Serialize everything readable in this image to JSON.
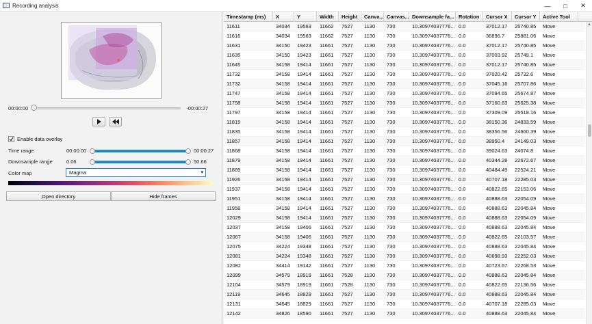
{
  "window": {
    "title": "Recording analysis",
    "icon": "window-app-icon"
  },
  "player": {
    "time_start": "00:00:00",
    "time_end": "-00:00:27",
    "progress": 0.0
  },
  "overlay": {
    "enable_label": "Enable data overlay",
    "enabled": true,
    "time_range": {
      "label": "Time range",
      "min": "00:00:00",
      "max": "00:00:27",
      "low": 0.0,
      "high": 1.0
    },
    "downsample_range": {
      "label": "Downsample range",
      "min": "0.06",
      "max": "50.66",
      "low": 0.0,
      "high": 1.0
    },
    "color_map": {
      "label": "Color map",
      "value": "Magma"
    }
  },
  "buttons": {
    "open_directory": "Open directory",
    "hide_frames": "Hide frames"
  },
  "colors": {
    "accent": "#1e88c9",
    "select_border": "#2a7fd1"
  },
  "table": {
    "columns": [
      "Timestamp (ms)",
      "X",
      "Y",
      "Width",
      "Height",
      "Canva...",
      "Canvas...",
      "Downsample fa...",
      "Rotation",
      "Cursor X",
      "Cursor Y",
      "Active Tool"
    ],
    "rows": [
      [
        "11611",
        "34034",
        "19563",
        "11662",
        "7527",
        "1130",
        "730",
        "10.30974037776...",
        "0.0",
        "37012.17",
        "25740.85",
        "Move"
      ],
      [
        "11616",
        "34034",
        "19563",
        "11662",
        "7527",
        "1130",
        "730",
        "10.30974037776...",
        "0.0",
        "36896.7",
        "25881.06",
        "Move"
      ],
      [
        "11631",
        "34150",
        "19423",
        "11661",
        "7527",
        "1130",
        "730",
        "10.30974037776...",
        "0.0",
        "37012.17",
        "25740.85",
        "Move"
      ],
      [
        "11635",
        "34150",
        "19423",
        "11661",
        "7527",
        "1130",
        "730",
        "10.30974037776...",
        "0.0",
        "37003.92",
        "25749.1",
        "Move"
      ],
      [
        "11645",
        "34158",
        "19414",
        "11661",
        "7527",
        "1130",
        "730",
        "10.30974037776...",
        "0.0",
        "37012.17",
        "25740.85",
        "Move"
      ],
      [
        "11732",
        "34158",
        "19414",
        "11661",
        "7527",
        "1130",
        "730",
        "10.30974037776...",
        "0.0",
        "37020.42",
        "25732.6",
        "Move"
      ],
      [
        "11732",
        "34158",
        "19414",
        "11661",
        "7527",
        "1130",
        "730",
        "10.30974037776...",
        "0.0",
        "37045.16",
        "25707.86",
        "Move"
      ],
      [
        "11747",
        "34158",
        "19414",
        "11661",
        "7527",
        "1130",
        "730",
        "10.30974037776...",
        "0.0",
        "37094.65",
        "25674.87",
        "Move"
      ],
      [
        "11758",
        "34158",
        "19414",
        "11661",
        "7527",
        "1130",
        "730",
        "10.30974037776...",
        "0.0",
        "37160.63",
        "25625.38",
        "Move"
      ],
      [
        "11797",
        "34158",
        "19414",
        "11661",
        "7527",
        "1130",
        "730",
        "10.30974037776...",
        "0.0",
        "37309.09",
        "25518.16",
        "Move"
      ],
      [
        "11815",
        "34158",
        "19414",
        "11661",
        "7527",
        "1130",
        "730",
        "10.30974037776...",
        "0.0",
        "38150.36",
        "24833.59",
        "Move"
      ],
      [
        "11835",
        "34158",
        "19414",
        "11661",
        "7527",
        "1130",
        "730",
        "10.30974037776...",
        "0.0",
        "38356.56",
        "24660.39",
        "Move"
      ],
      [
        "11857",
        "34158",
        "19414",
        "11661",
        "7527",
        "1130",
        "730",
        "10.30974037776...",
        "0.0",
        "38950.4",
        "24149.03",
        "Move"
      ],
      [
        "11868",
        "34158",
        "19414",
        "11661",
        "7527",
        "1130",
        "730",
        "10.30974037776...",
        "0.0",
        "39024.63",
        "24074.8",
        "Move"
      ],
      [
        "11879",
        "34158",
        "19414",
        "11661",
        "7527",
        "1130",
        "730",
        "10.30974037776...",
        "0.0",
        "40344.28",
        "22672.67",
        "Move"
      ],
      [
        "11889",
        "34158",
        "19414",
        "11661",
        "7527",
        "1130",
        "730",
        "10.30974037776...",
        "0.0",
        "40484.49",
        "22524.21",
        "Move"
      ],
      [
        "11926",
        "34158",
        "19414",
        "11661",
        "7527",
        "1130",
        "730",
        "10.30974037776...",
        "0.0",
        "40707.18",
        "22285.03",
        "Move"
      ],
      [
        "11937",
        "34158",
        "19414",
        "11661",
        "7527",
        "1130",
        "730",
        "10.30974037776...",
        "0.0",
        "40822.65",
        "22153.06",
        "Move"
      ],
      [
        "11951",
        "34158",
        "19414",
        "11661",
        "7527",
        "1130",
        "730",
        "10.30974037776...",
        "0.0",
        "40888.63",
        "22054.09",
        "Move"
      ],
      [
        "11958",
        "34158",
        "19414",
        "11661",
        "7527",
        "1130",
        "730",
        "10.30974037776...",
        "0.0",
        "40888.63",
        "22045.84",
        "Move"
      ],
      [
        "12029",
        "34158",
        "19414",
        "11661",
        "7527",
        "1130",
        "730",
        "10.30974037776...",
        "0.0",
        "40888.63",
        "22054.09",
        "Move"
      ],
      [
        "12037",
        "34158",
        "19406",
        "11661",
        "7527",
        "1130",
        "730",
        "10.30974037776...",
        "0.0",
        "40888.63",
        "22045.84",
        "Move"
      ],
      [
        "12067",
        "34158",
        "19406",
        "11661",
        "7527",
        "1130",
        "730",
        "10.30974037776...",
        "0.0",
        "40822.65",
        "22103.57",
        "Move"
      ],
      [
        "12075",
        "34224",
        "19348",
        "11661",
        "7527",
        "1130",
        "730",
        "10.30974037776...",
        "0.0",
        "40888.63",
        "22045.84",
        "Move"
      ],
      [
        "12081",
        "34224",
        "19348",
        "11661",
        "7527",
        "1130",
        "730",
        "10.30974037776...",
        "0.0",
        "40698.93",
        "22252.03",
        "Move"
      ],
      [
        "12082",
        "34414",
        "19142",
        "11661",
        "7527",
        "1130",
        "730",
        "10.30974037776...",
        "0.0",
        "40723.67",
        "22268.53",
        "Move"
      ],
      [
        "12099",
        "34579",
        "18919",
        "11661",
        "7528",
        "1130",
        "730",
        "10.30974037776...",
        "0.0",
        "40888.63",
        "22045.84",
        "Move"
      ],
      [
        "12104",
        "34579",
        "18919",
        "11661",
        "7528",
        "1130",
        "730",
        "10.30974037776...",
        "0.0",
        "40822.65",
        "22136.56",
        "Move"
      ],
      [
        "12119",
        "34645",
        "18829",
        "11661",
        "7527",
        "1130",
        "730",
        "10.30974037776...",
        "0.0",
        "40888.63",
        "22045.84",
        "Move"
      ],
      [
        "12131",
        "34645",
        "18829",
        "11661",
        "7527",
        "1130",
        "730",
        "10.30974037776...",
        "0.0",
        "40707.18",
        "22285.03",
        "Move"
      ],
      [
        "12142",
        "34826",
        "18590",
        "11661",
        "7527",
        "1130",
        "730",
        "10.30974037776...",
        "0.0",
        "40888.63",
        "22045.84",
        "Move"
      ]
    ]
  }
}
